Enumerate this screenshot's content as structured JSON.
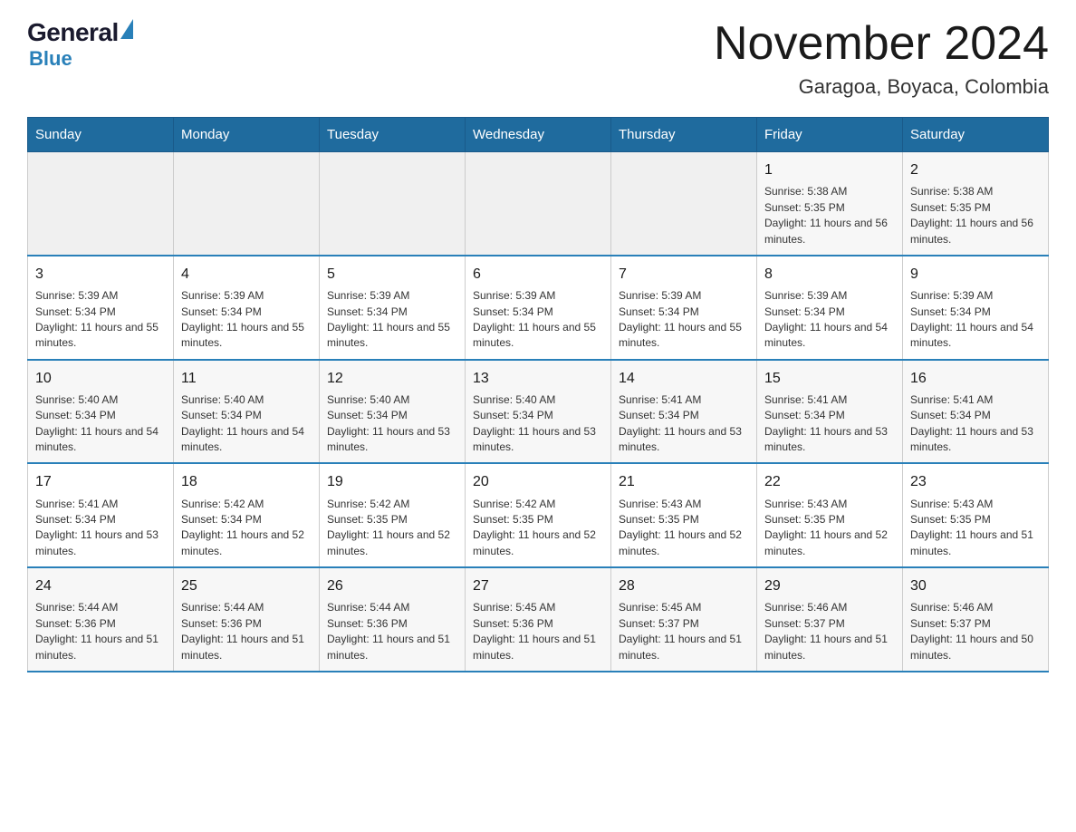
{
  "header": {
    "logo_general": "General",
    "logo_blue": "Blue",
    "month_title": "November 2024",
    "location": "Garagoa, Boyaca, Colombia"
  },
  "days_of_week": [
    "Sunday",
    "Monday",
    "Tuesday",
    "Wednesday",
    "Thursday",
    "Friday",
    "Saturday"
  ],
  "weeks": [
    [
      {
        "day": "",
        "info": ""
      },
      {
        "day": "",
        "info": ""
      },
      {
        "day": "",
        "info": ""
      },
      {
        "day": "",
        "info": ""
      },
      {
        "day": "",
        "info": ""
      },
      {
        "day": "1",
        "info": "Sunrise: 5:38 AM\nSunset: 5:35 PM\nDaylight: 11 hours and 56 minutes."
      },
      {
        "day": "2",
        "info": "Sunrise: 5:38 AM\nSunset: 5:35 PM\nDaylight: 11 hours and 56 minutes."
      }
    ],
    [
      {
        "day": "3",
        "info": "Sunrise: 5:39 AM\nSunset: 5:34 PM\nDaylight: 11 hours and 55 minutes."
      },
      {
        "day": "4",
        "info": "Sunrise: 5:39 AM\nSunset: 5:34 PM\nDaylight: 11 hours and 55 minutes."
      },
      {
        "day": "5",
        "info": "Sunrise: 5:39 AM\nSunset: 5:34 PM\nDaylight: 11 hours and 55 minutes."
      },
      {
        "day": "6",
        "info": "Sunrise: 5:39 AM\nSunset: 5:34 PM\nDaylight: 11 hours and 55 minutes."
      },
      {
        "day": "7",
        "info": "Sunrise: 5:39 AM\nSunset: 5:34 PM\nDaylight: 11 hours and 55 minutes."
      },
      {
        "day": "8",
        "info": "Sunrise: 5:39 AM\nSunset: 5:34 PM\nDaylight: 11 hours and 54 minutes."
      },
      {
        "day": "9",
        "info": "Sunrise: 5:39 AM\nSunset: 5:34 PM\nDaylight: 11 hours and 54 minutes."
      }
    ],
    [
      {
        "day": "10",
        "info": "Sunrise: 5:40 AM\nSunset: 5:34 PM\nDaylight: 11 hours and 54 minutes."
      },
      {
        "day": "11",
        "info": "Sunrise: 5:40 AM\nSunset: 5:34 PM\nDaylight: 11 hours and 54 minutes."
      },
      {
        "day": "12",
        "info": "Sunrise: 5:40 AM\nSunset: 5:34 PM\nDaylight: 11 hours and 53 minutes."
      },
      {
        "day": "13",
        "info": "Sunrise: 5:40 AM\nSunset: 5:34 PM\nDaylight: 11 hours and 53 minutes."
      },
      {
        "day": "14",
        "info": "Sunrise: 5:41 AM\nSunset: 5:34 PM\nDaylight: 11 hours and 53 minutes."
      },
      {
        "day": "15",
        "info": "Sunrise: 5:41 AM\nSunset: 5:34 PM\nDaylight: 11 hours and 53 minutes."
      },
      {
        "day": "16",
        "info": "Sunrise: 5:41 AM\nSunset: 5:34 PM\nDaylight: 11 hours and 53 minutes."
      }
    ],
    [
      {
        "day": "17",
        "info": "Sunrise: 5:41 AM\nSunset: 5:34 PM\nDaylight: 11 hours and 53 minutes."
      },
      {
        "day": "18",
        "info": "Sunrise: 5:42 AM\nSunset: 5:34 PM\nDaylight: 11 hours and 52 minutes."
      },
      {
        "day": "19",
        "info": "Sunrise: 5:42 AM\nSunset: 5:35 PM\nDaylight: 11 hours and 52 minutes."
      },
      {
        "day": "20",
        "info": "Sunrise: 5:42 AM\nSunset: 5:35 PM\nDaylight: 11 hours and 52 minutes."
      },
      {
        "day": "21",
        "info": "Sunrise: 5:43 AM\nSunset: 5:35 PM\nDaylight: 11 hours and 52 minutes."
      },
      {
        "day": "22",
        "info": "Sunrise: 5:43 AM\nSunset: 5:35 PM\nDaylight: 11 hours and 52 minutes."
      },
      {
        "day": "23",
        "info": "Sunrise: 5:43 AM\nSunset: 5:35 PM\nDaylight: 11 hours and 51 minutes."
      }
    ],
    [
      {
        "day": "24",
        "info": "Sunrise: 5:44 AM\nSunset: 5:36 PM\nDaylight: 11 hours and 51 minutes."
      },
      {
        "day": "25",
        "info": "Sunrise: 5:44 AM\nSunset: 5:36 PM\nDaylight: 11 hours and 51 minutes."
      },
      {
        "day": "26",
        "info": "Sunrise: 5:44 AM\nSunset: 5:36 PM\nDaylight: 11 hours and 51 minutes."
      },
      {
        "day": "27",
        "info": "Sunrise: 5:45 AM\nSunset: 5:36 PM\nDaylight: 11 hours and 51 minutes."
      },
      {
        "day": "28",
        "info": "Sunrise: 5:45 AM\nSunset: 5:37 PM\nDaylight: 11 hours and 51 minutes."
      },
      {
        "day": "29",
        "info": "Sunrise: 5:46 AM\nSunset: 5:37 PM\nDaylight: 11 hours and 51 minutes."
      },
      {
        "day": "30",
        "info": "Sunrise: 5:46 AM\nSunset: 5:37 PM\nDaylight: 11 hours and 50 minutes."
      }
    ]
  ]
}
